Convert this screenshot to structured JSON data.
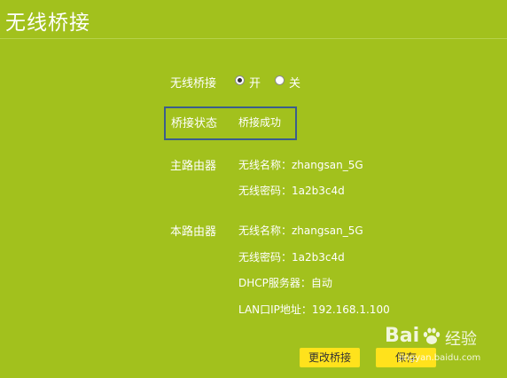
{
  "page": {
    "title": "无线桥接"
  },
  "bridge": {
    "label": "无线桥接",
    "option_on": "开",
    "option_off": "关",
    "selected": "on"
  },
  "status": {
    "label": "桥接状态",
    "value": "桥接成功"
  },
  "main_router": {
    "label": "主路由器",
    "ssid": "无线名称：zhangsan_5G",
    "password": "无线密码：1a2b3c4d"
  },
  "local_router": {
    "label": "本路由器",
    "ssid": "无线名称：zhangsan_5G",
    "password": "无线密码：1a2b3c4d",
    "dhcp": "DHCP服务器：自动",
    "lan_ip": "LAN口IP地址：192.168.1.100"
  },
  "buttons": {
    "change": "更改桥接",
    "save": "保存"
  },
  "watermark": {
    "brand": "Bai",
    "brand2": "经验",
    "url": "jingyan.baidu.com"
  },
  "colors": {
    "background": "#a2c11d",
    "button": "#ffe21c",
    "highlight_box": "#3b5d8c"
  }
}
